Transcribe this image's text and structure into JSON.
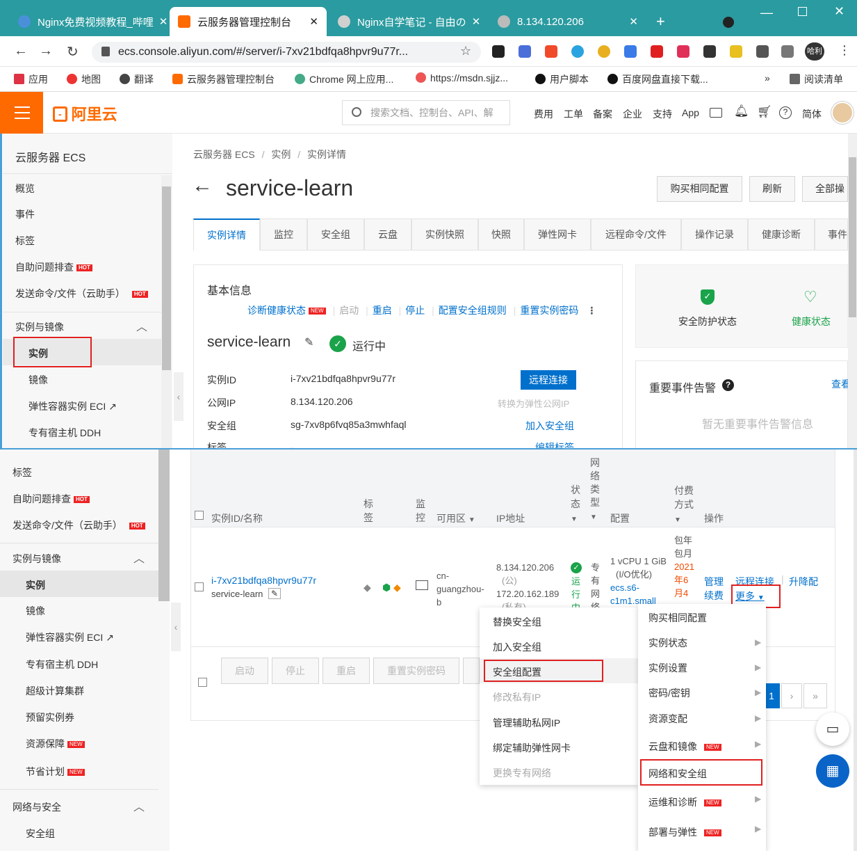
{
  "browser": {
    "tabs": [
      {
        "title": "Nginx免费视频教程_哔哩"
      },
      {
        "title": "云服务器管理控制台"
      },
      {
        "title": "Nginx自学笔记 - 自由の"
      },
      {
        "title": "8.134.120.206"
      }
    ],
    "url": "ecs.console.aliyun.com/#/server/i-7xv21bdfqa8hpvr9u77r...",
    "profile": "哈利",
    "bookmarks": [
      "应用",
      "地图",
      "翻译",
      "云服务器管理控制台",
      "Chrome 网上应用...",
      "https://msdn.sjjz...",
      "用户脚本",
      "百度网盘直接下载..."
    ],
    "reading_list": "阅读清单",
    "more": "»"
  },
  "header": {
    "logo": "阿里云",
    "search_placeholder": "搜索文档、控制台、API、解",
    "nav": [
      "费用",
      "工单",
      "备案",
      "企业",
      "支持",
      "App"
    ],
    "lang": "简体"
  },
  "sidebar_top": {
    "title": "云服务器 ECS",
    "items": [
      "概览",
      "事件",
      "标签",
      "自助问题排查",
      "发送命令/文件（云助手）"
    ],
    "group": "实例与镜像",
    "sub": [
      "实例",
      "镜像",
      "弹性容器实例 ECI",
      "专有宿主机 DDH"
    ],
    "hot": "HOT"
  },
  "main": {
    "breadcrumb": [
      "云服务器 ECS",
      "/",
      "实例",
      "/",
      "实例详情"
    ],
    "back": "←",
    "title": "service-learn",
    "buttons": [
      "购买相同配置",
      "刷新",
      "全部操"
    ],
    "tabs": [
      "实例详情",
      "监控",
      "安全组",
      "云盘",
      "实例快照",
      "快照",
      "弹性网卡",
      "远程命令/文件",
      "操作记录",
      "健康诊断",
      "事件"
    ],
    "basic_title": "基本信息",
    "actions": [
      "诊断健康状态",
      "启动",
      "重启",
      "停止",
      "配置安全组规则",
      "重置实例密码"
    ],
    "new_badge": "NEW",
    "instance_name": "service-learn",
    "status": "运行中",
    "fields": [
      {
        "label": "实例ID",
        "value": "i-7xv21bdfqa8hpvr9u77r",
        "action": "远程连接"
      },
      {
        "label": "公网IP",
        "value": "8.134.120.206",
        "action": "转换为弹性公网IP"
      },
      {
        "label": "安全组",
        "value": "sg-7xv8p6fvq85a3mwhfaql",
        "action": "加入安全组"
      },
      {
        "label": "标签",
        "value": "-",
        "action": "编辑标签"
      }
    ],
    "security_status": "安全防护状态",
    "health_status": "健康状态",
    "events_title": "重要事件告警",
    "events_link": "查看",
    "events_empty": "暂无重要事件告警信息"
  },
  "sidebar_bottom": {
    "items": [
      "标签",
      "自助问题排查",
      "发送命令/文件（云助手）"
    ],
    "group": "实例与镜像",
    "sub": [
      "实例",
      "镜像",
      "弹性容器实例 ECI",
      "专有宿主机 DDH",
      "超级计算集群",
      "预留实例券",
      "资源保障",
      "节省计划"
    ],
    "group2": "网络与安全",
    "sub2": [
      "安全组"
    ]
  },
  "table": {
    "headers": [
      "实例ID/名称",
      "标签",
      "监控",
      "可用区",
      "IP地址",
      "状态",
      "网络类型",
      "配置",
      "付费方式",
      "操作"
    ],
    "row": {
      "id": "i-7xv21bdfqa8hpvr9u77r",
      "name": "service-learn",
      "zone": [
        "cn-",
        "guangzhou-",
        "b"
      ],
      "ip": [
        "8.134.120.206",
        "(公)",
        "172.20.162.189",
        "(私有)"
      ],
      "status": [
        "运",
        "行",
        "中"
      ],
      "network": [
        "专",
        "有",
        "网",
        "络"
      ],
      "config": [
        "1 vCPU 1 GiB",
        "(I/O优化)",
        "ecs.s6-",
        "c1m1.small"
      ],
      "pay": [
        "包年",
        "包月",
        "2021",
        "年6",
        "月4"
      ],
      "ops": [
        "管理",
        "远程连接",
        "升降配",
        "续费",
        "更多"
      ]
    },
    "bulk": [
      "启动",
      "停止",
      "重启",
      "重置实例密码"
    ],
    "pager": [
      "1",
      "›",
      "»"
    ]
  },
  "submenu": [
    "替换安全组",
    "加入安全组",
    "安全组配置",
    "修改私有IP",
    "管理辅助私网IP",
    "绑定辅助弹性网卡",
    "更换专有网络"
  ],
  "moremenu": [
    "购买相同配置",
    "实例状态",
    "实例设置",
    "密码/密钥",
    "资源变配",
    "云盘和镜像",
    "网络和安全组",
    "运维和诊断",
    "部署与弹性"
  ]
}
